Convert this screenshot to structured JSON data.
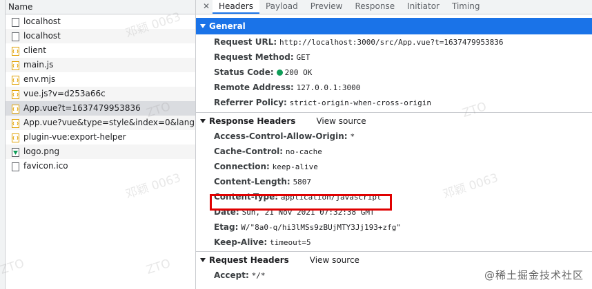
{
  "list": {
    "header": "Name",
    "items": [
      {
        "name": "localhost",
        "icon": "document-icon"
      },
      {
        "name": "localhost",
        "icon": "document-icon"
      },
      {
        "name": "client",
        "icon": "script-icon"
      },
      {
        "name": "main.js",
        "icon": "script-icon"
      },
      {
        "name": "env.mjs",
        "icon": "script-icon"
      },
      {
        "name": "vue.js?v=d253a66c",
        "icon": "script-icon"
      },
      {
        "name": "App.vue?t=1637479953836",
        "icon": "script-icon"
      },
      {
        "name": "App.vue?vue&type=style&index=0&lang.css",
        "icon": "script-icon"
      },
      {
        "name": "plugin-vue:export-helper",
        "icon": "script-icon"
      },
      {
        "name": "logo.png",
        "icon": "image-icon"
      },
      {
        "name": "favicon.ico",
        "icon": "document-icon"
      }
    ],
    "selected_index": 6
  },
  "tabs": {
    "close": "✕",
    "items": [
      "Headers",
      "Payload",
      "Preview",
      "Response",
      "Initiator",
      "Timing"
    ],
    "active_index": 0
  },
  "general": {
    "title": "General",
    "rows": [
      {
        "key": "Request URL:",
        "value": "http://localhost:3000/src/App.vue?t=1637479953836"
      },
      {
        "key": "Request Method:",
        "value": "GET"
      },
      {
        "key": "Status Code:",
        "value": "200 OK"
      },
      {
        "key": "Remote Address:",
        "value": "127.0.0.1:3000"
      },
      {
        "key": "Referrer Policy:",
        "value": "strict-origin-when-cross-origin"
      }
    ]
  },
  "response_headers": {
    "title": "Response Headers",
    "view_source": "View source",
    "rows": [
      {
        "key": "Access-Control-Allow-Origin:",
        "value": "*"
      },
      {
        "key": "Cache-Control:",
        "value": "no-cache"
      },
      {
        "key": "Connection:",
        "value": "keep-alive"
      },
      {
        "key": "Content-Length:",
        "value": "5807"
      },
      {
        "key": "Content-Type:",
        "value": "application/javascript"
      },
      {
        "key": "Date:",
        "value": "Sun, 21 Nov 2021 07:32:38 GMT"
      },
      {
        "key": "Etag:",
        "value": "W/\"8a0-q/hi3lMSs9zBUjMTY3Jj193+zfg\""
      },
      {
        "key": "Keep-Alive:",
        "value": "timeout=5"
      }
    ]
  },
  "request_headers": {
    "title": "Request Headers",
    "view_source": "View source",
    "rows": [
      {
        "key": "Accept:",
        "value": "*/*"
      }
    ]
  },
  "watermark": {
    "user": "邓颖 0063",
    "company": "ZTO"
  },
  "brand": "@稀土掘金技术社区",
  "colors": {
    "accent": "#1a73e8",
    "status_ok": "#0f9d58",
    "highlight": "#e00000"
  }
}
